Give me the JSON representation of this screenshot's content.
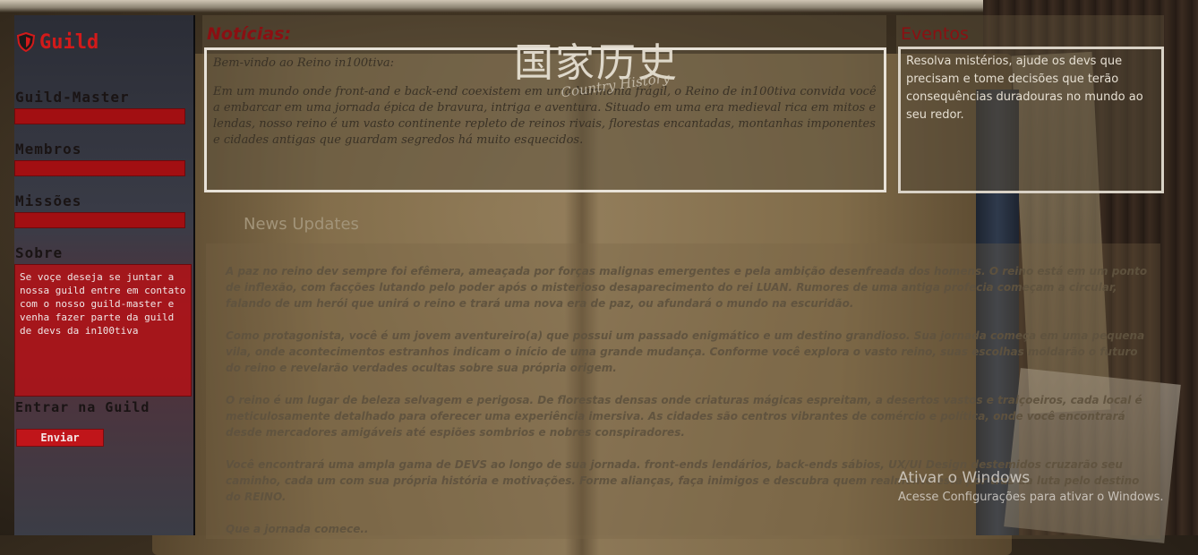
{
  "sidebar": {
    "title": "Guild",
    "guild_master_label": "Guild-Master",
    "members_label": "Membros",
    "missions_label": "Missões",
    "about_label": "Sobre",
    "about_text": "Se voçe deseja se juntar a nossa guild entre em contato com o nosso guild-master e venha fazer parte da guild de devs da in100tiva",
    "join_label": "Entrar na Guild",
    "send_button": "Enviar"
  },
  "news": {
    "heading": "Notícias:",
    "logo_kanji": "国家历史",
    "logo_sub": "Country History",
    "greeting": "Bem-vindo ao Reino in100tiva:",
    "body": "Em um mundo onde front-and e back-end coexistem em uma harmonia frágil, o Reino de in100tiva convida você a embarcar em uma jornada épica de bravura, intriga e aventura. Situado em uma era medieval rica em mitos e lendas, nosso reino é um vasto continente repleto de reinos rivais, florestas encantadas, montanhas imponentes e cidades antigas que guardam segredos há muito esquecidos."
  },
  "events": {
    "heading": "Eventos",
    "body": "Resolva mistérios, ajude os devs que precisam e tome decisões que terão consequências duradouras no mundo ao seu redor."
  },
  "updates": {
    "title": "News Updates",
    "paragraphs": [
      "A paz no reino dev sempre foi efêmera, ameaçada por forças malignas emergentes e pela ambição desenfreada dos homens. O reino está em um ponto de inflexão, com facções lutando pelo poder após o misterioso desaparecimento do rei LUAN. Rumores de uma antiga profecia começam a circular, falando de um herói que unirá o reino e trará uma nova era de paz, ou afundará o mundo na escuridão.",
      "Como protagonista, você é um jovem aventureiro(a) que possui um passado enigmático e um destino grandioso. Sua jornada começa em uma pequena vila, onde acontecimentos estranhos indicam o início de uma grande mudança. Conforme você explora o vasto reino, suas escolhas moldarão o futuro do reino e revelarão verdades ocultas sobre sua própria origem.",
      "O reino é um lugar de beleza selvagem e perigosa. De florestas densas onde criaturas mágicas espreitam, a desertos vastos e traiçoeiros, cada local é meticulosamente detalhado para oferecer uma experiência imersiva. As cidades são centros vibrantes de comércio e política, onde você encontrará desde mercadores amigáveis até espiões sombrios e nobres conspiradores.",
      "Você encontrará uma ampla gama de DEVS ao longo de sua jornada. front-ends lendários, back-ends sábios, UX/UI Design destemidos cruzarão seu caminho, cada um com sua própria história e motivações. Forme alianças, faça inimigos e descubra quem realmente está por trás da luta pelo destino do REINO.",
      "Que a jornada comece.."
    ]
  },
  "windows": {
    "title": "Ativar o Windows",
    "subtitle": "Acesse Configurações para ativar o Windows."
  },
  "colors": {
    "accent_red": "#c0151a",
    "heading_red": "#8b0f12"
  }
}
